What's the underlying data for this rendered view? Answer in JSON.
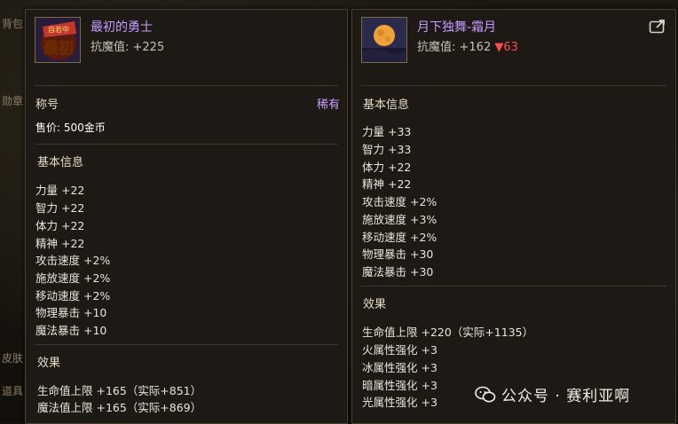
{
  "background": {
    "labels": [
      "背包",
      "勋章",
      "皮肤",
      "道具"
    ]
  },
  "left_item": {
    "name": "最初的勇士",
    "stat": "抗魔值: +225",
    "icon_text": "最初",
    "icon_tag": "自若中",
    "category": "称号",
    "rarity": "稀有",
    "price": "售价: 500金币",
    "basic_title": "基本信息",
    "basic_stats": [
      "力量 +22",
      "智力 +22",
      "体力 +22",
      "精神 +22",
      "攻击速度 +2%",
      "施放速度 +2%",
      "移动速度 +2%",
      "物理暴击 +10",
      "魔法暴击 +10"
    ],
    "effect_title": "效果",
    "effects": [
      "生命值上限 +165（实际+851）",
      "魔法值上限 +165（实际+869）"
    ]
  },
  "right_item": {
    "name": "月下独舞-霜月",
    "stat_base": "抗魔值: +162",
    "stat_diff": "▼63",
    "basic_title": "基本信息",
    "basic_stats": [
      "力量 +33",
      "智力 +33",
      "体力 +22",
      "精神 +22",
      "攻击速度 +2%",
      "施放速度 +3%",
      "移动速度 +2%",
      "物理暴击 +30",
      "魔法暴击 +30"
    ],
    "effect_title": "效果",
    "effects": [
      "生命值上限 +220（实际+1135）",
      "火属性强化 +3",
      "冰属性强化 +3",
      "暗属性强化 +3",
      "光属性强化 +3"
    ]
  },
  "watermark": {
    "text": "公众号 · 赛利亚啊"
  },
  "colors": {
    "rarity_purple": "#c79bff",
    "decrease_red": "#ff4d4d"
  },
  "icons": [
    "title-emblem-icon",
    "moon-icon",
    "share-icon",
    "wechat-icon"
  ]
}
